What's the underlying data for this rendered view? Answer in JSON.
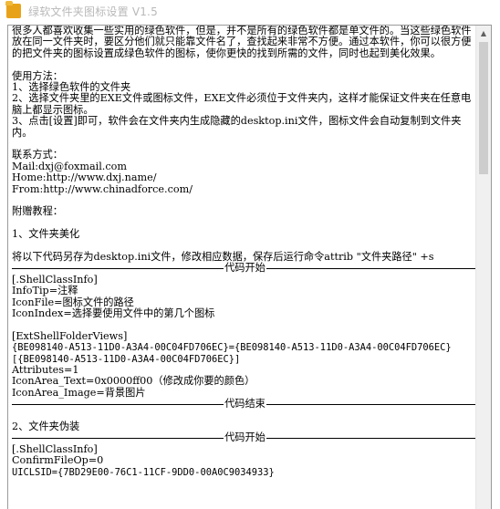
{
  "window": {
    "title": "绿软文件夹图标设置 V1.5"
  },
  "icons": {
    "app": "folder-icon",
    "scroll_up": "chevron-up-icon"
  },
  "content": {
    "paragraphs": [
      "很多人都喜欢收集一些实用的绿色软件，但是，并不是所有的绿色软件都是单文件的。当这些绿色软件放在同一文件夹时，要区分他们就只能靠文件名了，查找起来非常不方便。通过本软件，你可以很方便的把文件夹的图标设置成绿色软件的图标，使你更快的找到所需的文件，同时也起到美化效果。",
      "",
      "使用方法：",
      "1、选择绿色软件的文件夹",
      "2、选择文件夹里的EXE文件或图标文件，EXE文件必须位于文件夹内，这样才能保证文件夹在任意电脑上都显示图标。",
      "3、点击[设置]即可，软件会在文件夹内生成隐藏的desktop.ini文件，图标文件会自动复制到文件夹内。",
      "",
      "联系方式：",
      "Mail:dxj@foxmail.com",
      "Home:http://www.dxj.name/",
      "From:http://www.chinadforce.com/",
      "",
      "附赠教程：",
      "",
      "1、文件夹美化",
      "",
      "将以下代码另存为desktop.ini文件，修改相应数据，保存后运行命令attrib \"文件夹路径\" +s"
    ],
    "divider_start": "代码开始",
    "divider_end": "代码结束",
    "code1": [
      "[.ShellClassInfo]",
      "InfoTip=注释",
      "IconFile=图标文件的路径",
      "IconIndex=选择要使用文件中的第几个图标",
      "",
      "[ExtShellFolderViews]",
      "{BE098140-A513-11D0-A3A4-00C04FD706EC}={BE098140-A513-11D0-A3A4-00C04FD706EC}",
      "[{BE098140-A513-11D0-A3A4-00C04FD706EC}]",
      "Attributes=1",
      "IconArea_Text=0x0000ff00（修改成你要的颜色）",
      "IconArea_Image=背景图片"
    ],
    "section2_title": "2、文件夹伪装",
    "code2": [
      "[.ShellClassInfo]",
      "ConfirmFileOp=0",
      "UICLSID={7BD29E00-76C1-11CF-9DD0-00A0C9034933}"
    ]
  }
}
